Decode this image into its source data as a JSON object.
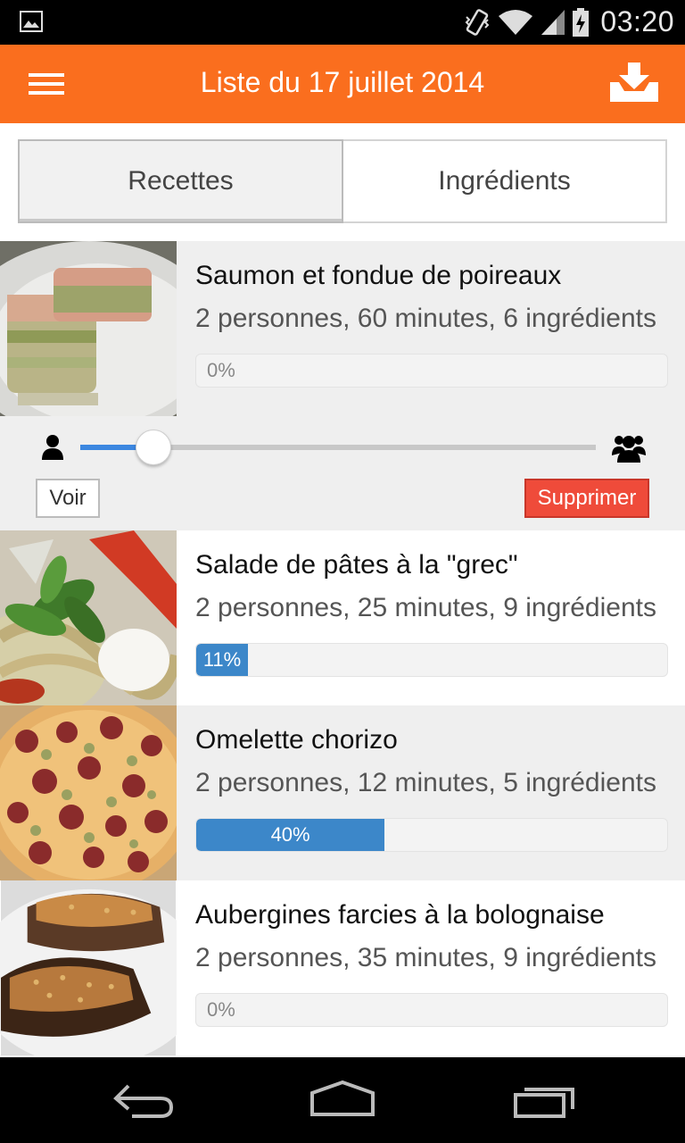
{
  "status_bar": {
    "time": "03:20",
    "icons": [
      "gallery-icon",
      "vibrate-icon",
      "wifi-icon",
      "signal-icon",
      "battery-charging-icon"
    ]
  },
  "action_bar": {
    "title": "Liste du 17 juillet 2014",
    "menu_icon": "hamburger-menu-icon",
    "download_icon": "download-icon"
  },
  "tabs": [
    {
      "label": "Recettes",
      "active": true
    },
    {
      "label": "Ingrédients",
      "active": false
    }
  ],
  "recipes": [
    {
      "title": "Saumon et fondue de poireaux",
      "meta": "2 personnes, 60 minutes, 6 ingrédients",
      "progress_label": "0%",
      "progress": 0,
      "expanded": true
    },
    {
      "title": "Salade de pâtes à la \"grec\"",
      "meta": "2 personnes, 25 minutes, 9 ingrédients",
      "progress_label": "11%",
      "progress": 11
    },
    {
      "title": "Omelette chorizo",
      "meta": "2 personnes, 12 minutes, 5 ingrédients",
      "progress_label": "40%",
      "progress": 40
    },
    {
      "title": "Aubergines farcies à la bolognaise",
      "meta": "2 personnes, 35 minutes, 9 ingrédients",
      "progress_label": "0%",
      "progress": 0
    }
  ],
  "expanded_panel": {
    "servings_slider_fraction": 0.14,
    "voir_label": "Voir",
    "supprimer_label": "Supprimer",
    "min_icon": "person-icon",
    "max_icon": "group-icon"
  },
  "nav_bar": {
    "back_icon": "back-icon",
    "home_icon": "home-icon",
    "recents_icon": "recents-icon"
  },
  "colors": {
    "accent": "#fa6e1e",
    "progress": "#3c87c9",
    "delete": "#ef4b3a",
    "slider": "#3c87e0"
  }
}
